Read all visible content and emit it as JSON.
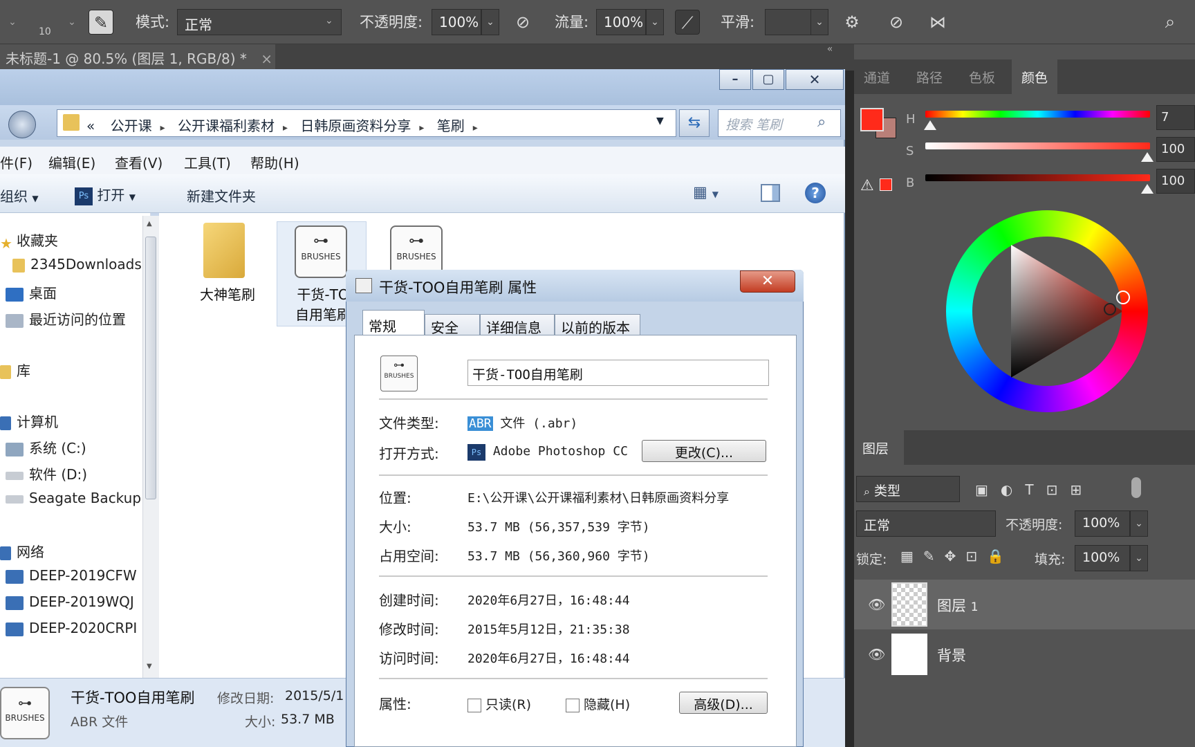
{
  "ps_options": {
    "size": "10",
    "mode_label": "模式:",
    "mode_value": "正常",
    "opacity_label": "不透明度:",
    "opacity_value": "100%",
    "flow_label": "流量:",
    "flow_value": "100%",
    "smooth_label": "平滑:",
    "smooth_value": ""
  },
  "doc_tab": {
    "title": "未标题-1 @ 80.5% (图层 1, RGB/8) *",
    "close": "×"
  },
  "color_panel": {
    "tabs": [
      "通道",
      "路径",
      "色板",
      "颜色"
    ],
    "active_tab": "颜色",
    "h_label": "H",
    "h_value": "7",
    "s_label": "S",
    "s_value": "100",
    "b_label": "B",
    "b_value": "100",
    "fg_color": "#ff2a1a",
    "bg_color": "#b97f78"
  },
  "layers_panel": {
    "tab": "图层",
    "filter": "类型",
    "blend": "正常",
    "opacity_label": "不透明度:",
    "opacity_value": "100%",
    "lock_label": "锁定:",
    "fill_label": "填充:",
    "fill_value": "100%",
    "layers": [
      {
        "name": "图层",
        "num": "1"
      },
      {
        "name": "背景"
      }
    ]
  },
  "explorer": {
    "address": [
      "«",
      "公开课",
      "公开课福利素材",
      "日韩原画资料分享",
      "笔刷"
    ],
    "search_placeholder": "搜索 笔刷",
    "menu": [
      "件(F)",
      "编辑(E)",
      "查看(V)",
      "工具(T)",
      "帮助(H)"
    ],
    "cmd_organize": "组织",
    "cmd_open": "打开",
    "cmd_new_folder": "新建文件夹",
    "nav": {
      "favorites": "收藏夹",
      "fav_items": [
        "2345Downloads",
        "桌面",
        "最近访问的位置"
      ],
      "library": "库",
      "computer": "计算机",
      "drives": [
        "系统 (C:)",
        "软件 (D:)",
        "Seagate Backup"
      ],
      "network": "网络",
      "net_items": [
        "DEEP-2019CFW",
        "DEEP-2019WQJ",
        "DEEP-2020CRPI"
      ]
    },
    "files": [
      {
        "name": "大神笔刷"
      },
      {
        "name_line1": "干货-TO",
        "name_line2": "自用笔刷",
        "icon_text": "BRUSHES"
      },
      {
        "icon_text": "BRUSHES"
      }
    ],
    "details": {
      "name": "干货-TOO自用笔刷",
      "modified_label": "修改日期:",
      "modified_value": "2015/5/1",
      "type": "ABR 文件",
      "size_label": "大小:",
      "size_value": "53.7 MB",
      "icon_text": "BRUSHES"
    }
  },
  "properties": {
    "title": "干货-TOO自用笔刷 属性",
    "tabs": [
      "常规",
      "安全",
      "详细信息",
      "以前的版本"
    ],
    "filename": "干货-TOO自用笔刷",
    "icon_text": "BRUSHES",
    "type_label": "文件类型:",
    "type_badge": "ABR",
    "type_value": "文件 (.abr)",
    "open_label": "打开方式:",
    "open_app": "Adobe Photoshop CC",
    "change_btn": "更改(C)...",
    "location_label": "位置:",
    "location_value": "E:\\公开课\\公开课福利素材\\日韩原画资料分享",
    "size_label": "大小:",
    "size_value": "53.7 MB (56,357,539 字节)",
    "disk_label": "占用空间:",
    "disk_value": "53.7 MB (56,360,960 字节)",
    "created_label": "创建时间:",
    "created_value": "2020年6月27日，16:48:44",
    "modified_label": "修改时间:",
    "modified_value": "2015年5月12日，21:35:38",
    "accessed_label": "访问时间:",
    "accessed_value": "2020年6月27日，16:48:44",
    "attr_label": "属性:",
    "readonly": "只读(R)",
    "hidden": "隐藏(H)",
    "advanced_btn": "高级(D)..."
  }
}
